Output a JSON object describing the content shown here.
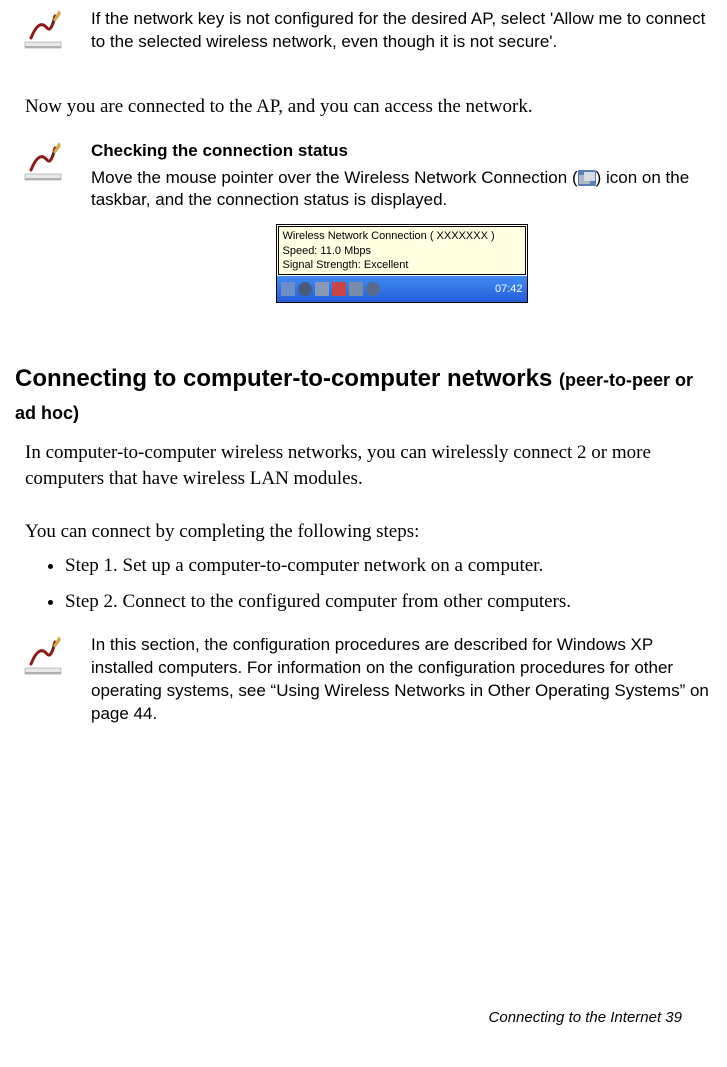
{
  "note1": {
    "text": "If the network key is not configured for the desired AP, select 'Allow me to connect to the selected wireless network, even though it is not secure'."
  },
  "connectedPara": "Now you are connected to the AP, and you can access the network.",
  "note2": {
    "title": "Checking the connection status",
    "text_before": "Move the mouse pointer over the Wireless Network Connection (",
    "text_after": ") icon on the taskbar, and the connection status is displayed."
  },
  "tooltip": {
    "line1": "Wireless Network Connection (   XXXXXXX   )",
    "line2": "Speed: 11.0 Mbps",
    "line3": "Signal Strength: Excellent",
    "clock": "07:42"
  },
  "heading": {
    "main": "Connecting to computer-to-computer networks ",
    "sub": "(peer-to-peer or ad hoc)"
  },
  "introPara": "In computer-to-computer wireless networks, you can wirelessly connect 2 or more computers that have wireless LAN modules.",
  "stepsIntro": "You can connect by completing the following steps:",
  "steps": [
    "Step 1. Set up a computer-to-computer network on a computer.",
    "Step 2. Connect to the configured computer from other computers."
  ],
  "note3": {
    "text": "In this section, the configuration procedures are described for Windows XP installed computers. For information on the configuration procedures for other operating systems, see “Using Wireless Networks in Other Operating Systems” on page 44."
  },
  "footer": {
    "text": "Connecting to the Internet   39"
  }
}
